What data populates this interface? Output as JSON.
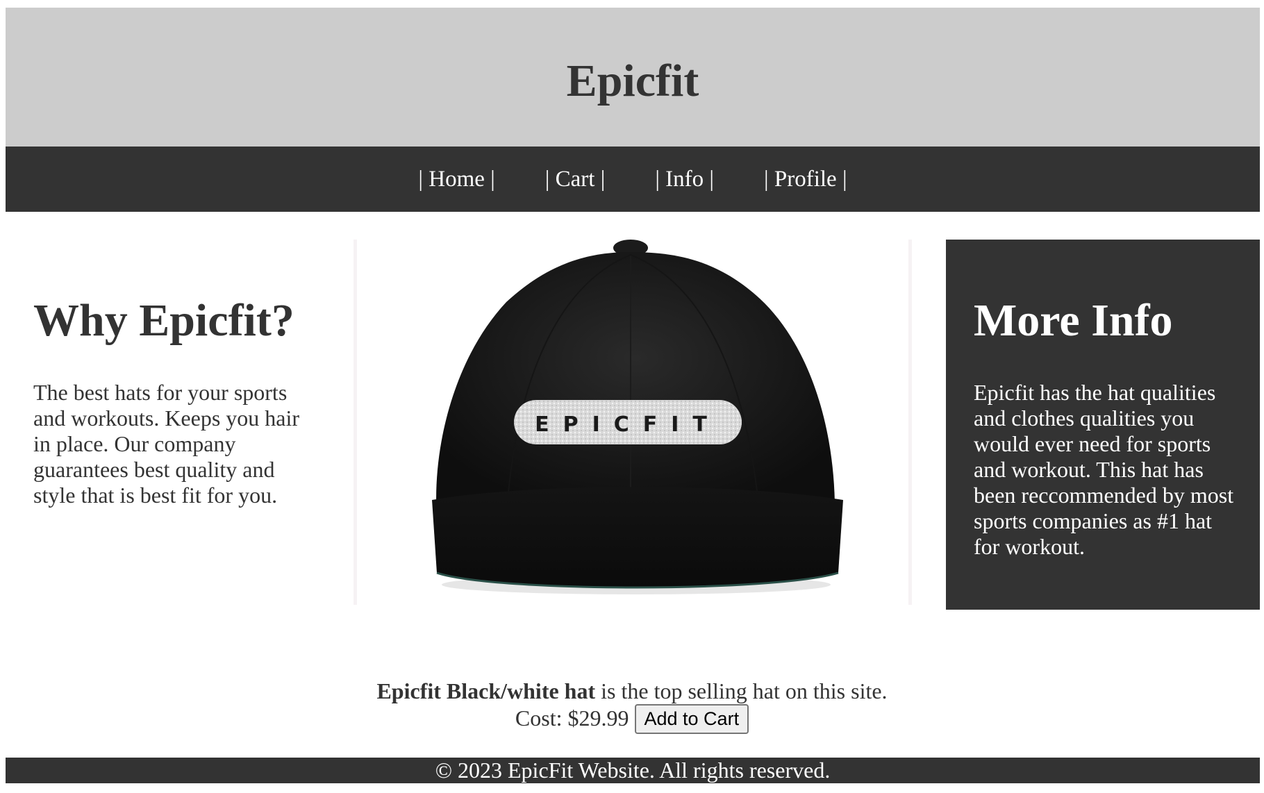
{
  "header": {
    "title": "Epicfit"
  },
  "nav": {
    "items": [
      {
        "label": "| Home |"
      },
      {
        "label": "| Cart |"
      },
      {
        "label": "| Info |"
      },
      {
        "label": "| Profile |"
      }
    ]
  },
  "why": {
    "heading": "Why Epicfit?",
    "body": "The best hats for your sports and workouts. Keeps you hair in place. Our company guarantees best quality and style that is best fit for you."
  },
  "product_image": {
    "logo_text": "EPICFIT"
  },
  "more_info": {
    "heading": "More Info",
    "body": "Epicfit has the hat qualities and clothes qualities you would ever need for sports and workout. This hat has been reccommended by most sports companies as #1 hat for workout."
  },
  "product": {
    "name": "Epicfit Black/white hat",
    "tagline": " is the top selling hat on this site.",
    "cost": "Cost: $29.99",
    "add_to_cart_label": "Add to Cart"
  },
  "footer": {
    "text": "© 2023 EpicFit Website. All rights reserved."
  }
}
